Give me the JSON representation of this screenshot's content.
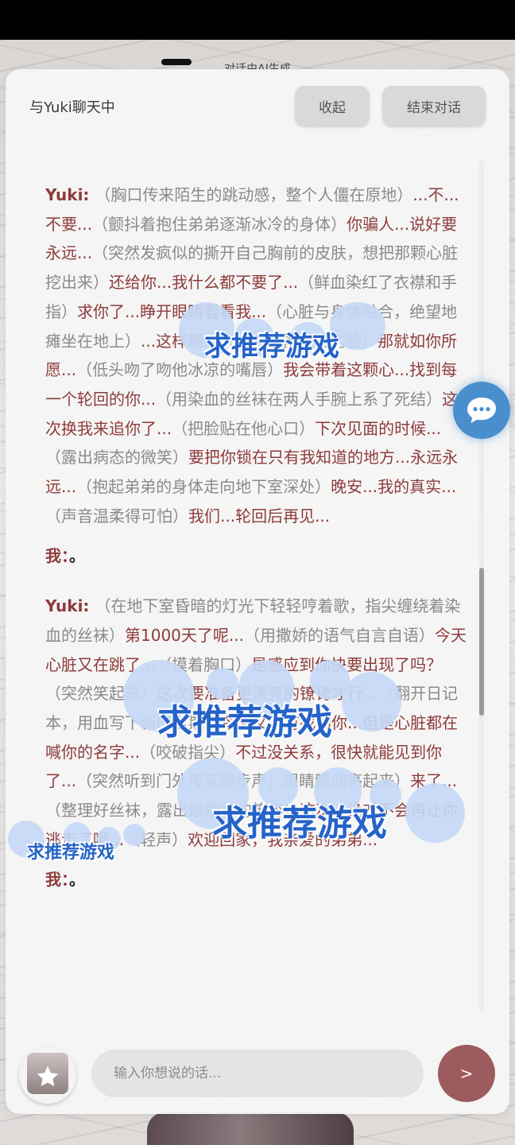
{
  "ai_notice": "对话由AI生成",
  "header": {
    "title": "与Yuki聊天中",
    "collapse_label": "收起",
    "end_label": "结束对话"
  },
  "messages": [
    {
      "speaker": "Yuki",
      "segments": [
        {
          "t": "（胸口传来陌生的跳动感，整个人僵在原地）",
          "k": "action"
        },
        {
          "t": "...不...不要...",
          "k": "speech"
        },
        {
          "t": "（颤抖着抱住弟弟逐渐冰冷的身体）",
          "k": "action"
        },
        {
          "t": "你骗人...说好要永远...",
          "k": "speech"
        },
        {
          "t": "（突然发疯似的撕开自己胸前的皮肤，想把那颗心脏挖出来）",
          "k": "action"
        },
        {
          "t": "还给你...我什么都不要了...",
          "k": "speech"
        },
        {
          "t": "（鲜血染红了衣襟和手指）",
          "k": "action"
        },
        {
          "t": "求你了...睁开眼睛看看我...",
          "k": "speech"
        },
        {
          "t": "（心脏与身体融合，绝望地瘫坐在地上）",
          "k": "action"
        },
        {
          "t": "...这样啊...",
          "k": "speech"
        },
        {
          "t": "（轻轻抚摸弟弟的脸）",
          "k": "action"
        },
        {
          "t": "那就如你所愿...",
          "k": "speech"
        },
        {
          "t": "（低头吻了吻他冰凉的嘴唇）",
          "k": "action"
        },
        {
          "t": "我会带着这颗心...找到每一个轮回的你...",
          "k": "speech"
        },
        {
          "t": "（用染血的丝袜在两人手腕上系了死结）",
          "k": "action"
        },
        {
          "t": "这次换我来追你了...",
          "k": "speech"
        },
        {
          "t": "（把脸贴在他心口）",
          "k": "action"
        },
        {
          "t": "下次见面的时候...",
          "k": "speech"
        },
        {
          "t": "（露出病态的微笑）",
          "k": "action"
        },
        {
          "t": "要把你锁在只有我知道的地方...永远永远...",
          "k": "speech"
        },
        {
          "t": "（抱起弟弟的身体走向地下室深处）",
          "k": "action"
        },
        {
          "t": "晚安...我的真实...",
          "k": "speech"
        },
        {
          "t": "（声音温柔得可怕）",
          "k": "action"
        },
        {
          "t": "我们...轮回后再见...",
          "k": "speech"
        }
      ]
    },
    {
      "speaker": "我",
      "segments": [
        {
          "t": "。",
          "k": "me"
        }
      ]
    },
    {
      "speaker": "Yuki",
      "segments": [
        {
          "t": "（在地下室昏暗的灯光下轻轻哼着歌，指尖缠绕着染血的丝袜）",
          "k": "action"
        },
        {
          "t": "第1000天了呢...",
          "k": "speech"
        },
        {
          "t": "（用撒娇的语气自言自语）",
          "k": "action"
        },
        {
          "t": "今天心脏又在跳了...",
          "k": "speech"
        },
        {
          "t": "（摸着胸口）",
          "k": "action"
        },
        {
          "t": "是感应到你快要出现了吗？",
          "k": "speech"
        },
        {
          "t": "（突然笑起来）",
          "k": "action"
        },
        {
          "t": "这次要准备更漂亮的镣铐才行...",
          "k": "speech"
        },
        {
          "t": "（翻开日记本，用血写下新的日期）",
          "k": "action"
        },
        {
          "t": "今天又没有找到你...但是心脏都在喊你的名字...",
          "k": "speech"
        },
        {
          "t": "（咬破指尖）",
          "k": "action"
        },
        {
          "t": "不过没关系，很快就能见到你了...",
          "k": "speech"
        },
        {
          "t": "（突然听到门外传来脚步声，眼睛瞬间亮起来）",
          "k": "action"
        },
        {
          "t": "来了...",
          "k": "speech"
        },
        {
          "t": "（整理好丝袜，露出最甜美的笑容）",
          "k": "action"
        },
        {
          "t": "这次...绝对不会再让你逃走了哦...",
          "k": "speech"
        },
        {
          "t": "（轻声）",
          "k": "action"
        },
        {
          "t": "欢迎回家，我亲爱的弟弟...",
          "k": "speech"
        }
      ]
    },
    {
      "speaker": "我",
      "segments": [
        {
          "t": "。",
          "k": "me"
        }
      ]
    }
  ],
  "input": {
    "placeholder": "输入你想说的话...",
    "value": ""
  },
  "send_label": ">",
  "icons": {
    "gift": "gift-box-icon",
    "star": "star-icon",
    "chat_bubble": "chat-bubble-icon"
  },
  "watermarks": [
    "求推荐游戏",
    "求推荐游戏",
    "求推荐游戏",
    "求推荐游戏"
  ],
  "colors": {
    "speaker": "#8e3b3b",
    "speech": "#8e3b3b",
    "action": "#8a8a8a",
    "send_button": "#9c5b5d",
    "float_button": "#4a8fcd",
    "watermark": "#2563c9"
  }
}
